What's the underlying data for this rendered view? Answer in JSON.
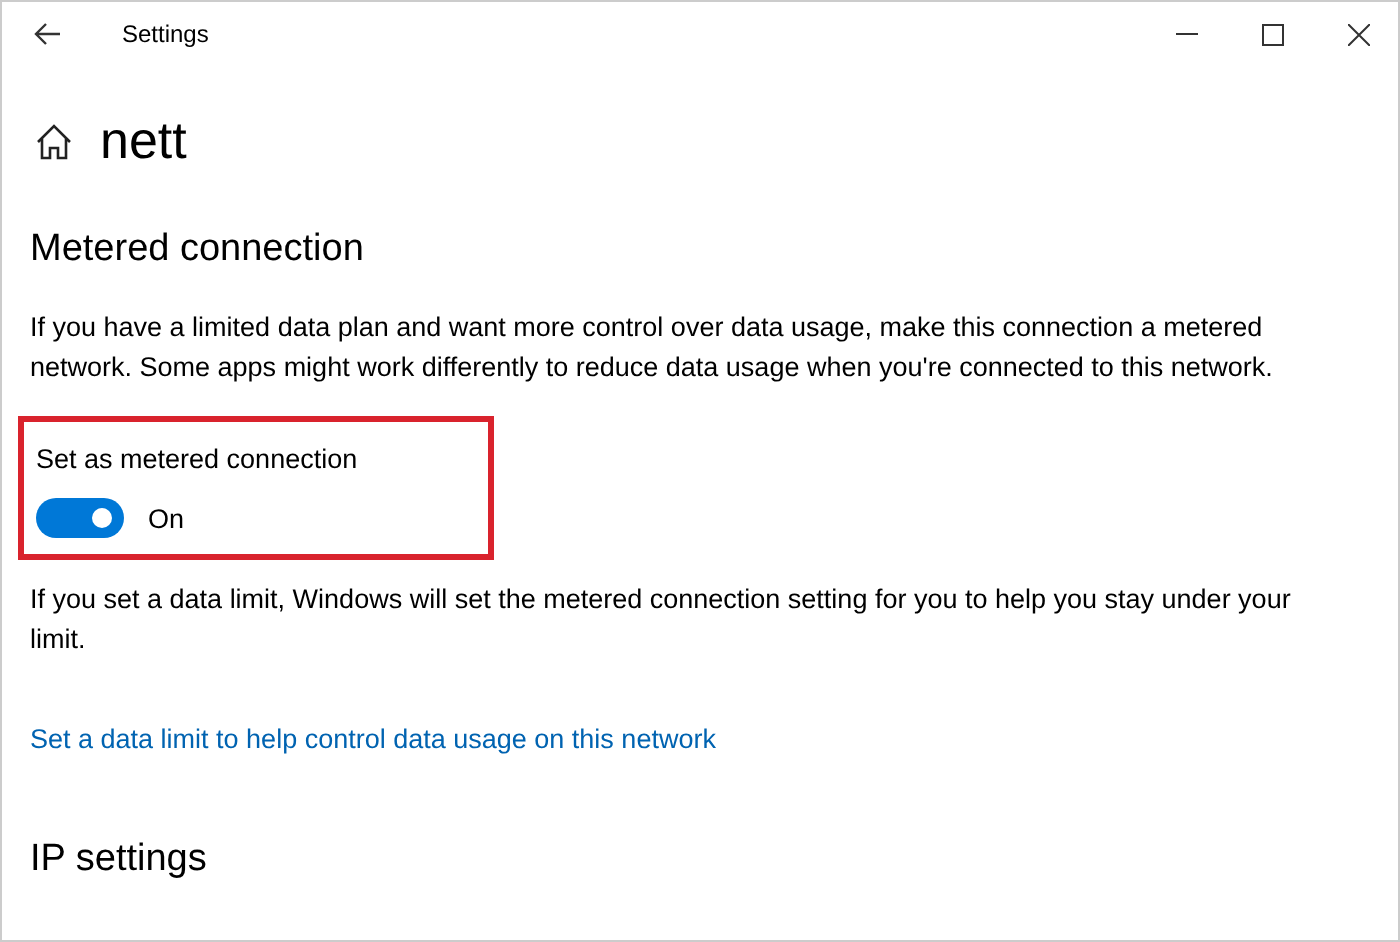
{
  "window": {
    "title": "Settings"
  },
  "page": {
    "title": "nett"
  },
  "section": {
    "heading": "Metered connection",
    "description": "If you have a limited data plan and want more control over data usage, make this connection a metered network. Some apps might work differently to reduce data usage when you're connected to this network."
  },
  "toggle": {
    "label": "Set as metered connection",
    "on": true,
    "state_text": "On",
    "highlighted": true
  },
  "note": "If you set a data limit, Windows will set the metered connection setting for you to help you stay under your limit.",
  "link": "Set a data limit to help control data usage on this network",
  "next_section": {
    "heading": "IP settings"
  }
}
